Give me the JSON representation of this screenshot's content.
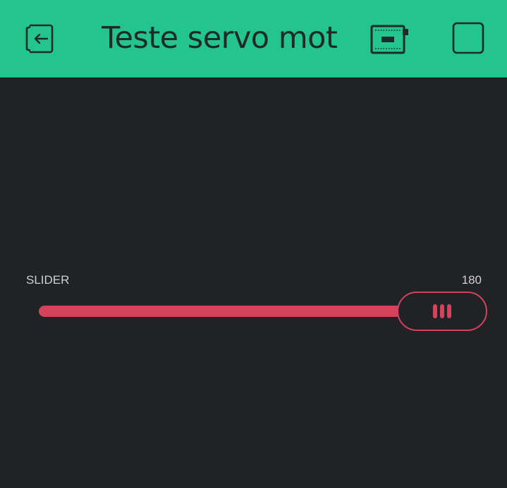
{
  "header": {
    "title": "Teste servo motor",
    "background_color": "#23c48e",
    "icons": {
      "back": "exit-project-icon",
      "device": "device-board-icon",
      "square": "stop-square-icon"
    }
  },
  "slider": {
    "label": "SLIDER",
    "value": "180",
    "min": 0,
    "max": 180,
    "accent_color": "#d3435c"
  },
  "theme": {
    "background": "#212226",
    "label_color": "#cfd1d4"
  }
}
